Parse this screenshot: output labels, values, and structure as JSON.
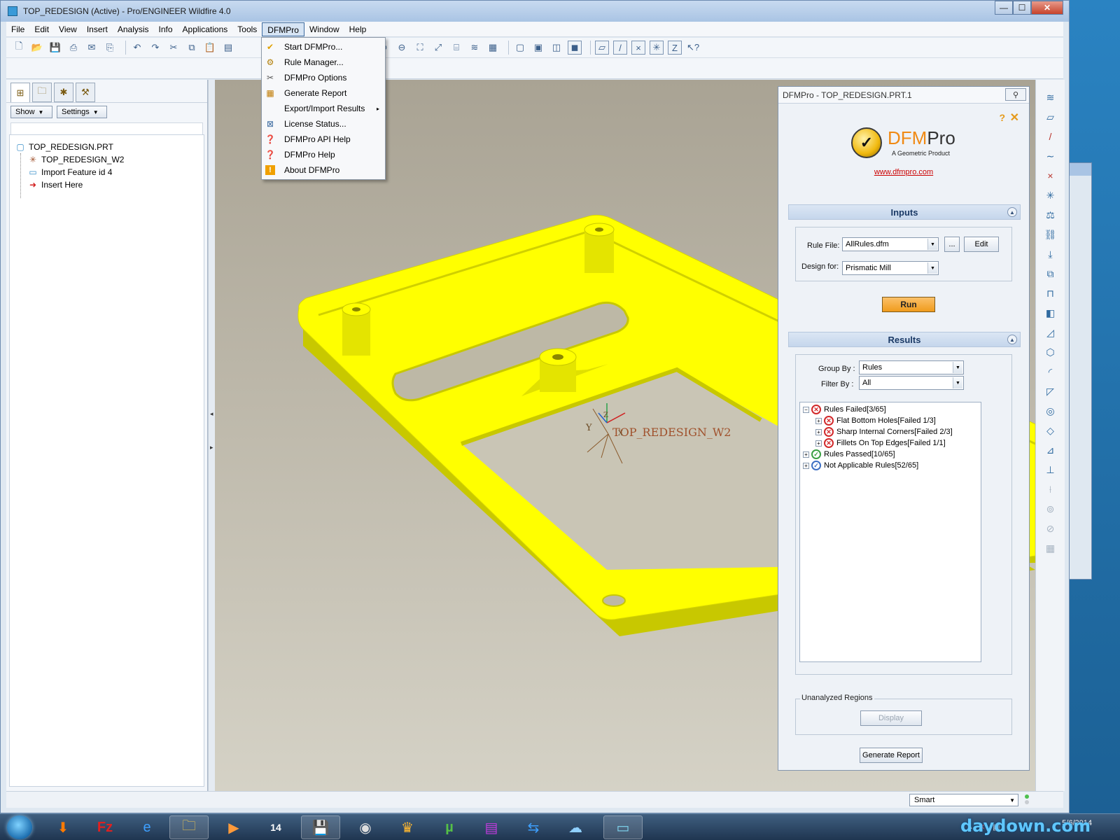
{
  "window": {
    "title": "TOP_REDESIGN (Active) - Pro/ENGINEER Wildfire 4.0",
    "controls": {
      "minimize": "—",
      "maximize": "☐",
      "close": "✕"
    }
  },
  "menubar": [
    "File",
    "Edit",
    "View",
    "Insert",
    "Analysis",
    "Info",
    "Applications",
    "Tools",
    "DFMPro",
    "Window",
    "Help"
  ],
  "dfmpro_menu": {
    "items": [
      {
        "label": "Start DFMPro...",
        "icon": "check-circle-icon"
      },
      {
        "label": "Rule Manager...",
        "icon": "rule-manager-icon"
      },
      {
        "label": "DFMPro Options",
        "icon": "tools-icon"
      },
      {
        "label": "Generate Report",
        "icon": "report-icon"
      },
      {
        "label": "Export/Import Results",
        "icon": "",
        "submenu": "▸"
      },
      {
        "label": "License Status...",
        "icon": "license-icon"
      },
      {
        "label": "DFMPro API Help",
        "icon": "help-bubble-icon"
      },
      {
        "label": "DFMPro Help",
        "icon": "help-bubble-icon"
      },
      {
        "label": "About DFMPro",
        "icon": "info-warning-icon"
      }
    ]
  },
  "left_panel": {
    "show_label": "Show",
    "settings_label": "Settings",
    "tree": [
      {
        "label": "TOP_REDESIGN.PRT",
        "icon": "part-icon"
      },
      {
        "label": "TOP_REDESIGN_W2",
        "icon": "csys-icon"
      },
      {
        "label": "Import Feature id 4",
        "icon": "import-feature-icon"
      },
      {
        "label": "Insert Here",
        "icon": "insert-arrow-icon"
      }
    ]
  },
  "viewport": {
    "csys_label": "TOP_REDESIGN_W2",
    "axis_x": "X",
    "axis_y": "Y",
    "axis_z": "Z",
    "part_color": "#ffff00",
    "edge_color": "#c8c800"
  },
  "dfmpro_panel": {
    "title": "DFMPro - TOP_REDESIGN.PRT.1",
    "help": "?",
    "close": "✕",
    "logo_brand_1": "DFM",
    "logo_brand_2": "Pro",
    "logo_tagline": "A Geometric Product",
    "website": "www.dfmpro.com",
    "inputs": {
      "heading": "Inputs",
      "rule_file_label": "Rule File:",
      "rule_file_value": "AllRules.dfm",
      "browse_label": "...",
      "edit_label": "Edit",
      "design_for_label": "Design for:",
      "design_for_value": "Prismatic Mill",
      "run_label": "Run"
    },
    "results": {
      "heading": "Results",
      "group_by_label": "Group By :",
      "group_by_value": "Rules",
      "filter_by_label": "Filter By :",
      "filter_by_value": "All",
      "tree": [
        {
          "label": "Rules Failed[3/65]",
          "status": "fail",
          "expander": "−",
          "level": 0
        },
        {
          "label": "Flat Bottom Holes[Failed 1/3]",
          "status": "fail",
          "expander": "+",
          "level": 1
        },
        {
          "label": "Sharp Internal Corners[Failed 2/3]",
          "status": "fail",
          "expander": "+",
          "level": 1
        },
        {
          "label": "Fillets On Top Edges[Failed 1/1]",
          "status": "fail",
          "expander": "+",
          "level": 1
        },
        {
          "label": "Rules Passed[10/65]",
          "status": "pass",
          "expander": "+",
          "level": 0
        },
        {
          "label": "Not Applicable Rules[52/65]",
          "status": "na",
          "expander": "+",
          "level": 0
        }
      ]
    },
    "unanalyzed": {
      "legend": "Unanalyzed Regions",
      "display_label": "Display"
    },
    "generate_report_label": "Generate Report"
  },
  "statusbar": {
    "filter_value": "Smart"
  },
  "taskbar": {
    "date": "5/6/2014",
    "watermark": "daydown.com"
  },
  "colors": {
    "accent": "#f09b1c",
    "fail": "#d2282a",
    "pass": "#3aa043",
    "not_applicable": "#3d6fc3",
    "link": "#cc0000"
  }
}
